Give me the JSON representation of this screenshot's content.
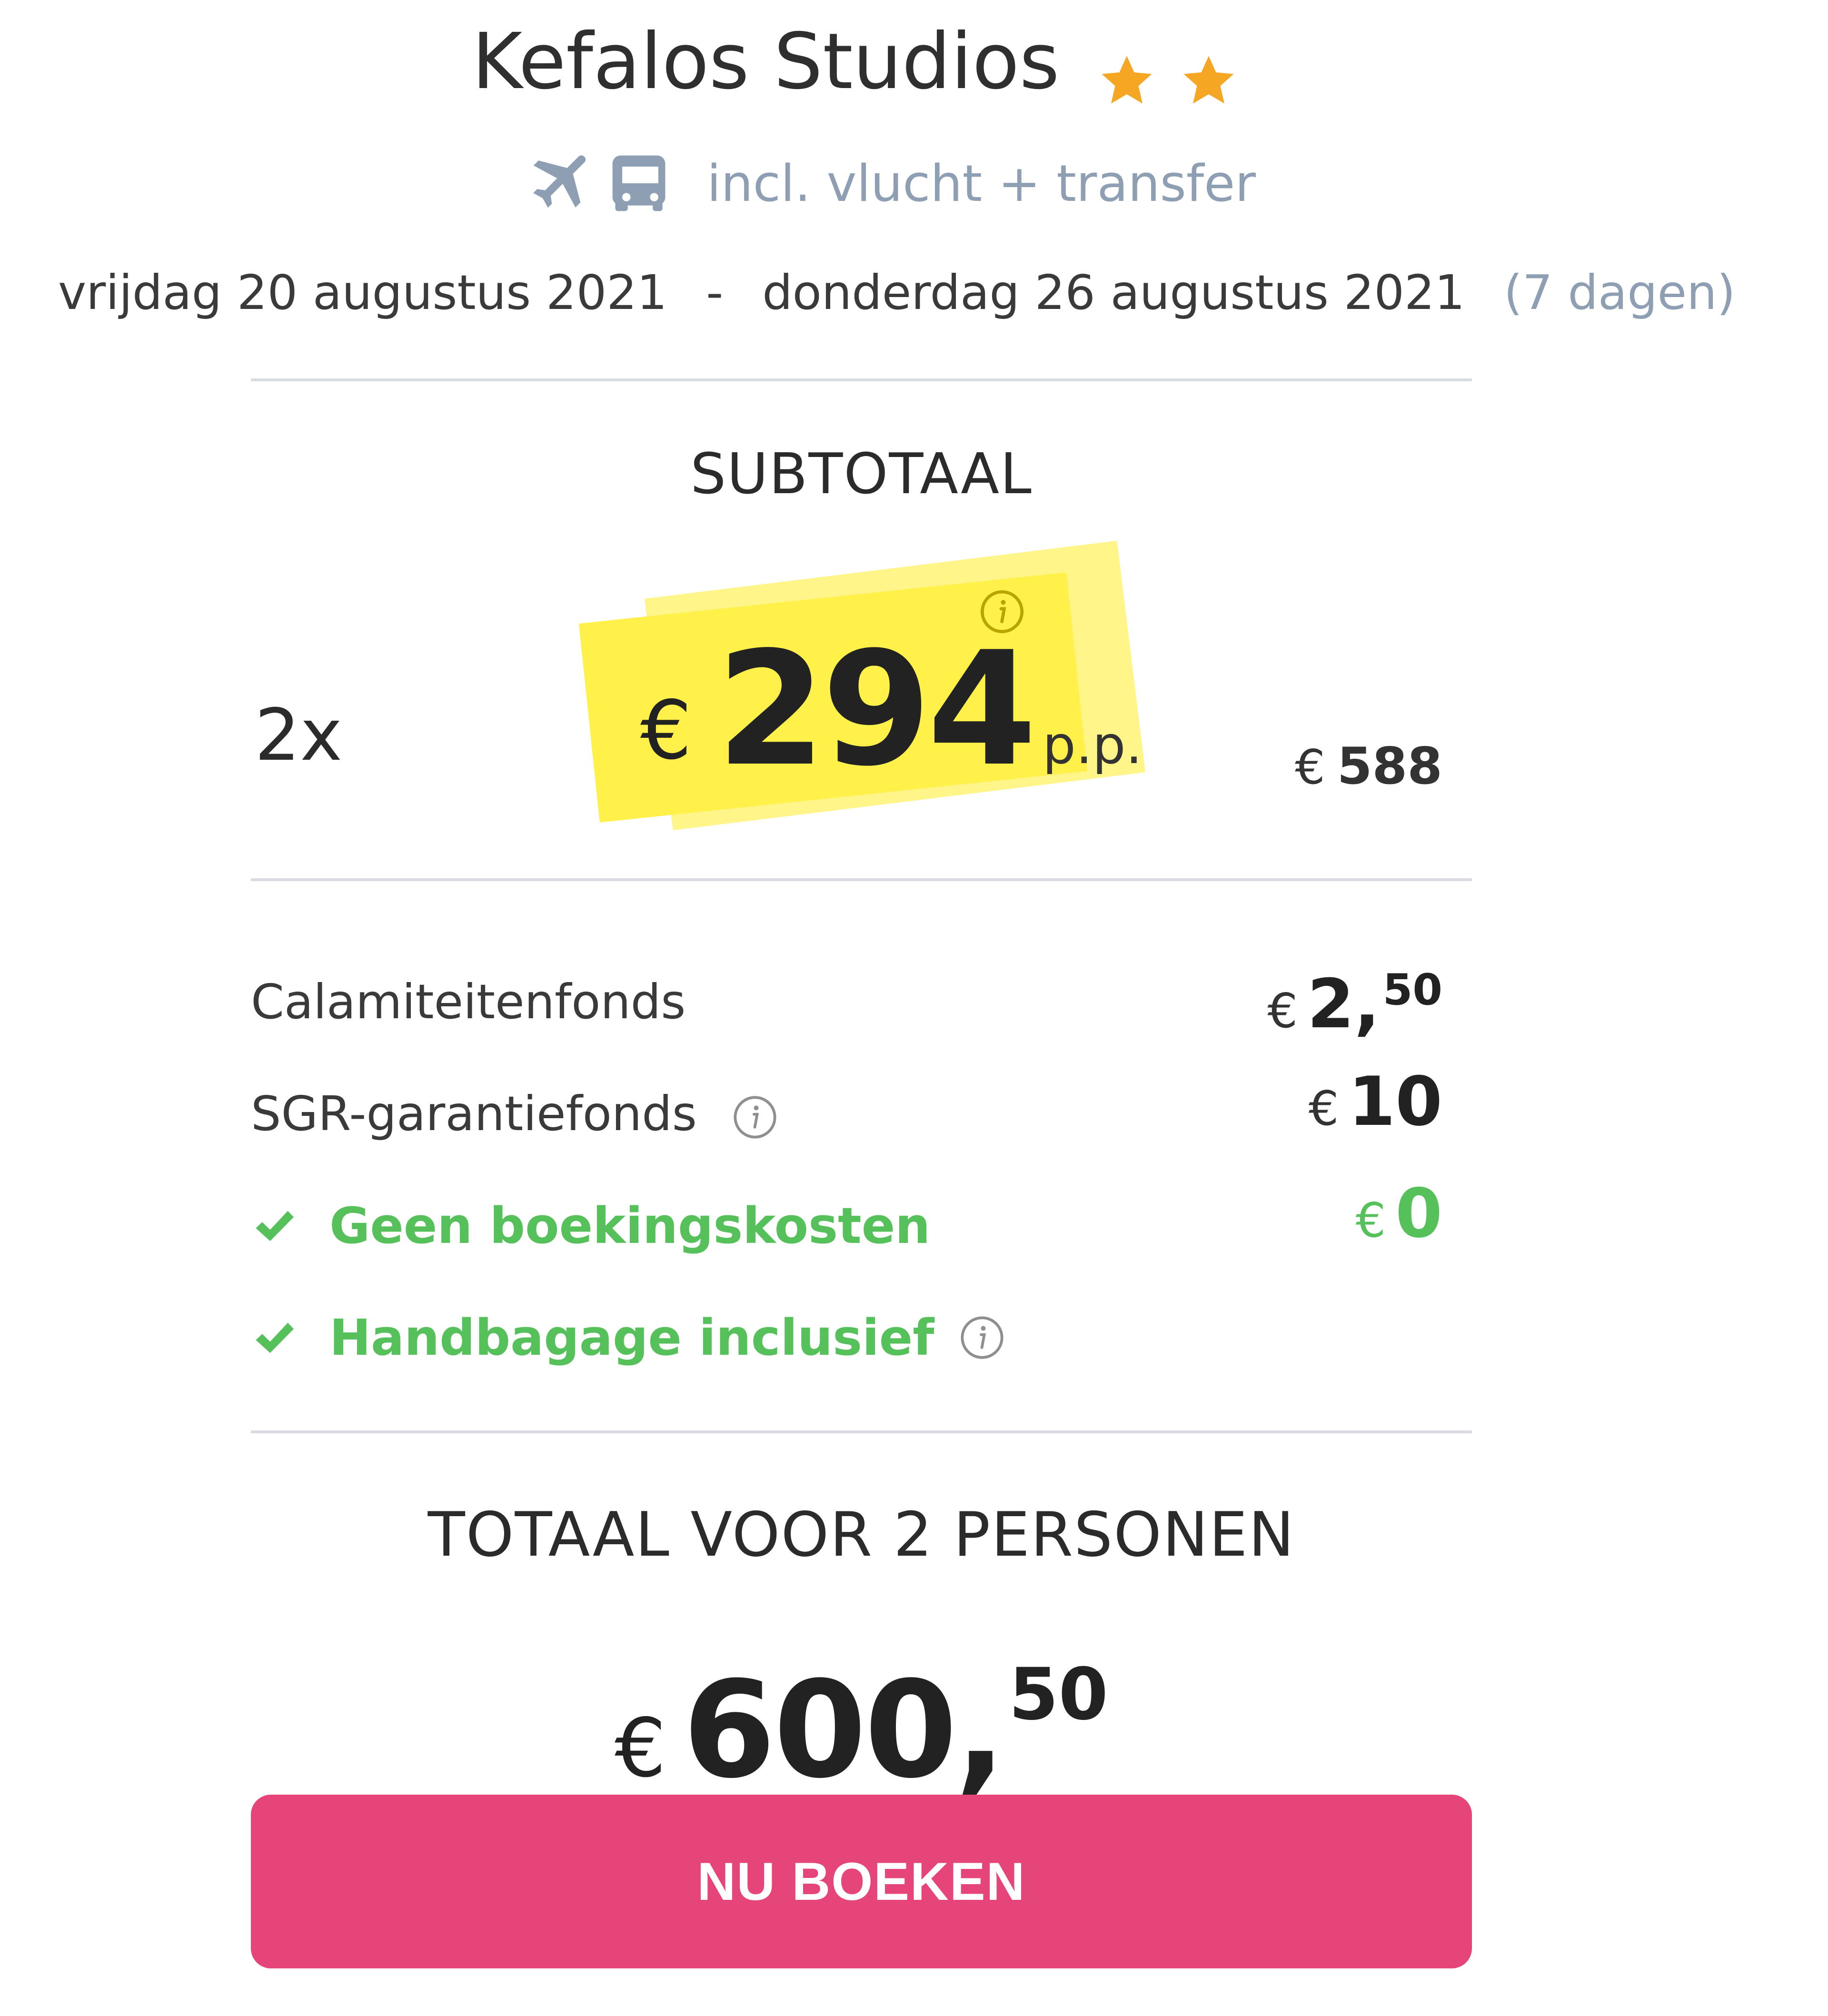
{
  "header": {
    "hotel_name": "Kefalos Studios",
    "star_count": 2,
    "star_color": "#f5a623",
    "includes_text": "incl. vlucht + transfer",
    "includes_icons": [
      "plane-icon",
      "bus-icon"
    ],
    "icon_color": "#8f9fb3"
  },
  "dates": {
    "start": "vrijdag 20 augustus 2021",
    "separator": "-",
    "end": "donderdag 26 augustus 2021",
    "duration": "(7 dagen)"
  },
  "subtotal": {
    "heading": "SUBTOTAAL",
    "quantity": "2x",
    "currency": "€",
    "price_per_person": "294",
    "unit": "p.p.",
    "sum_currency": "€",
    "sum": "588",
    "highlight_color": "#fff14a"
  },
  "fees": [
    {
      "label": "Calamiteitenfonds",
      "currency": "€",
      "amount": "2,",
      "cents": "50"
    },
    {
      "label": "SGR-garantiefonds",
      "currency": "€",
      "amount": "10",
      "cents": "",
      "info_icon": true
    },
    {
      "label": "Geen boekingskosten",
      "currency": "€",
      "amount": "0",
      "cents": "",
      "included": true
    }
  ],
  "perks": [
    {
      "label": "Handbagage inclusief",
      "info_icon": true
    }
  ],
  "total": {
    "heading": "TOTAAL VOOR 2 PERSONEN",
    "currency": "€",
    "amount": "600,",
    "cents": "50"
  },
  "cta": {
    "label": "NU BOEKEN",
    "color": "#e6457a"
  },
  "colors": {
    "green": "#56c15a",
    "muted": "#8f9fb3",
    "divider": "#d7dde3"
  }
}
